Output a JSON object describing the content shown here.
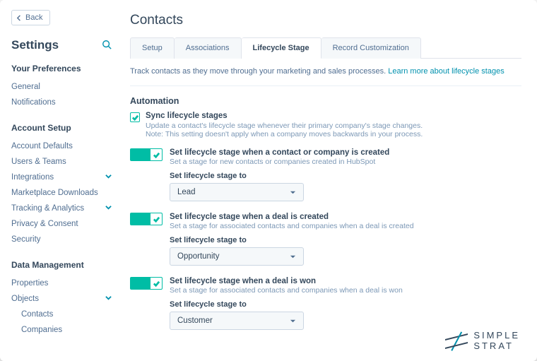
{
  "back_label": "Back",
  "settings_title": "Settings",
  "sidebar": {
    "prefs_heading": "Your Preferences",
    "general": "General",
    "notifications": "Notifications",
    "account_heading": "Account Setup",
    "account_defaults": "Account Defaults",
    "users_teams": "Users & Teams",
    "integrations": "Integrations",
    "marketplace": "Marketplace Downloads",
    "tracking": "Tracking & Analytics",
    "privacy": "Privacy & Consent",
    "security": "Security",
    "data_heading": "Data Management",
    "properties": "Properties",
    "objects": "Objects",
    "contacts": "Contacts",
    "companies": "Companies"
  },
  "page": {
    "title": "Contacts",
    "tabs": {
      "setup": "Setup",
      "associations": "Associations",
      "lifecycle": "Lifecycle Stage",
      "record": "Record Customization"
    },
    "desc_text": "Track contacts as they move through your marketing and sales processes. ",
    "desc_link": "Learn more about lifecycle stages",
    "automation_heading": "Automation",
    "sync": {
      "label": "Sync lifecycle stages",
      "help": "Update a contact's lifecycle stage whenever their primary company's stage changes. Note: This setting doesn't apply when a company moves backwards in your process."
    },
    "set_stage_label": "Set lifecycle stage to",
    "block1": {
      "title": "Set lifecycle stage when a contact or company is created",
      "help": "Set a stage for new contacts or companies created in HubSpot",
      "value": "Lead"
    },
    "block2": {
      "title": "Set lifecycle stage when a deal is created",
      "help": "Set a stage for associated contacts and companies when a deal is created",
      "value": "Opportunity"
    },
    "block3": {
      "title": "Set lifecycle stage when a deal is won",
      "help": "Set a stage for associated contacts and companies when a deal is won",
      "value": "Customer"
    }
  },
  "brand": {
    "line1": "SIMPLE",
    "line2": "STRAT"
  }
}
